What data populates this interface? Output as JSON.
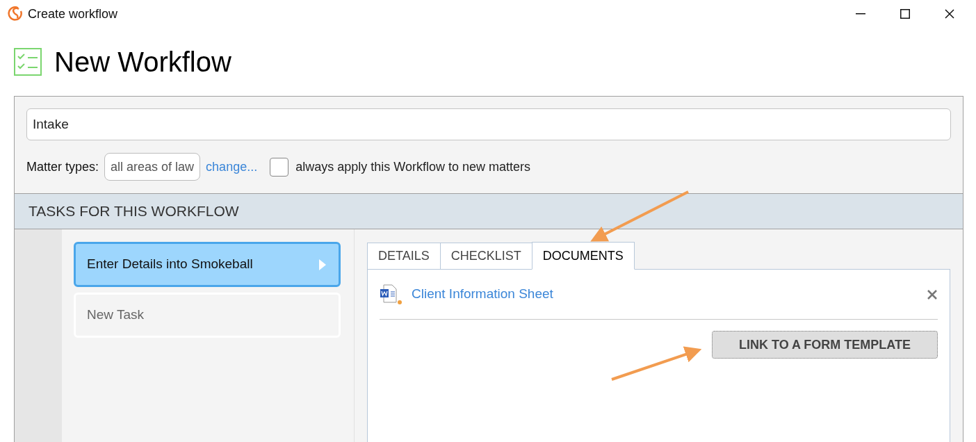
{
  "window": {
    "title": "Create workflow"
  },
  "heading": "New Workflow",
  "name_field": {
    "value": "Intake"
  },
  "matter_types": {
    "label": "Matter types:",
    "value": "all areas of law",
    "change_link": "change...",
    "always_apply": {
      "label": "always apply this Workflow to new matters",
      "checked": false
    }
  },
  "tasks_header": "TASKS FOR THIS WORKFLOW",
  "tasks": [
    {
      "label": "Enter Details into Smokeball",
      "selected": true
    },
    {
      "label": "New Task",
      "selected": false
    }
  ],
  "tabs": [
    {
      "label": "DETAILS",
      "selected": false
    },
    {
      "label": "CHECKLIST",
      "selected": false
    },
    {
      "label": "DOCUMENTS",
      "selected": true
    }
  ],
  "documents": [
    {
      "name": "Client Information Sheet"
    }
  ],
  "link_button": "LINK TO A FORM TEMPLATE"
}
